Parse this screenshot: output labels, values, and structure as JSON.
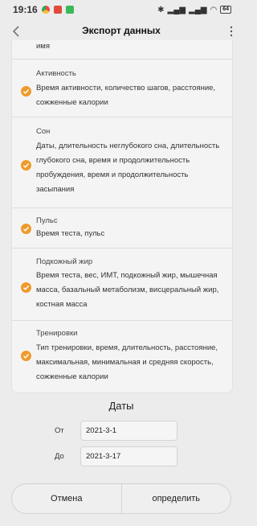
{
  "status_bar": {
    "time": "19:16",
    "battery": "64"
  },
  "header": {
    "title": "Экспорт данных"
  },
  "truncated_top": "имя",
  "items": [
    {
      "title": "Активность",
      "description": "Время активности, количество шагов, расстояние, сожженные калории"
    },
    {
      "title": "Сон",
      "description": "Даты, длительность неглубокого сна, длительность глубокого сна, время и продолжительность пробуждения, время и продолжительность засыпания"
    },
    {
      "title": "Пульс",
      "description": "Время теста, пульс"
    },
    {
      "title": "Подкожный жир",
      "description": "Время теста, вес, ИМТ, подкожный жир, мышечная масса, базальный метаболизм, висцеральный жир, костная масса"
    },
    {
      "title": "Тренировки",
      "description": "Тип тренировки, время, длительность, расстояние, максимальная, минимальная и средняя скорость, сожженные калории"
    }
  ],
  "dates": {
    "title": "Даты",
    "from_label": "От",
    "from_value": "2021-3-1",
    "to_label": "До",
    "to_value": "2021-3-17"
  },
  "buttons": {
    "cancel": "Отмена",
    "confirm": "определить"
  },
  "colors": {
    "accent": "#ef9a2a",
    "background": "#ececec"
  }
}
